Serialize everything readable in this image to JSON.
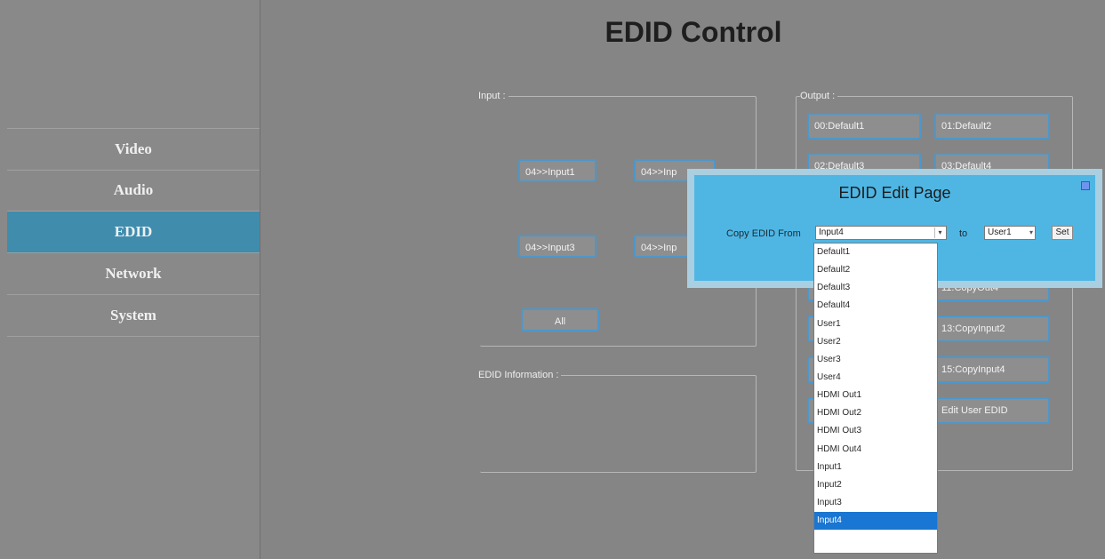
{
  "page_title": "EDID Control",
  "sidebar": {
    "items": [
      {
        "label": "Video",
        "active": false
      },
      {
        "label": "Audio",
        "active": false
      },
      {
        "label": "EDID",
        "active": true
      },
      {
        "label": "Network",
        "active": false
      },
      {
        "label": "System",
        "active": false
      }
    ]
  },
  "input_group": {
    "legend": "Input :",
    "buttons": [
      "04>>Input1",
      "04>>Inp",
      "04>>Input3",
      "04>>Inp",
      "All"
    ]
  },
  "output_group": {
    "legend": "Output :",
    "buttons": [
      "00:Default1",
      "01:Default2",
      "02:Default3",
      "03:Default4",
      "",
      "11:CopyOut4",
      "",
      "13:CopyInput2",
      "",
      "15:CopyInput4",
      "",
      "Edit User EDID"
    ]
  },
  "edid_info": {
    "legend": "EDID Information :"
  },
  "modal": {
    "title": "EDID Edit Page",
    "copy_label": "Copy EDID From",
    "source_value": "Input4",
    "to_label": "to",
    "dest_value": "User1",
    "set_label": "Set"
  },
  "dropdown": {
    "options": [
      "Default1",
      "Default2",
      "Default3",
      "Default4",
      "User1",
      "User2",
      "User3",
      "User4",
      "HDMI Out1",
      "HDMI Out2",
      "HDMI Out3",
      "HDMI Out4",
      "Input1",
      "Input2",
      "Input3",
      "Input4"
    ],
    "selected_index": 15
  },
  "colors": {
    "active_nav": "#3f8cad",
    "button_border": "#4d97ca",
    "modal_bg": "#4fb6e3",
    "selected_option": "#1976d2"
  }
}
